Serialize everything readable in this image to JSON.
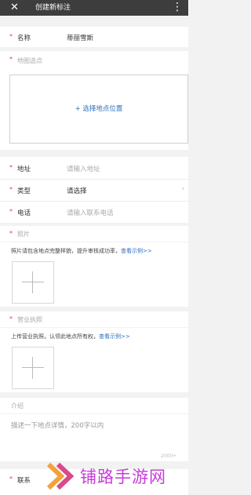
{
  "header": {
    "close_icon": "close-icon",
    "title": "创建新标注",
    "more_icon": "more-vertical-icon"
  },
  "required_mark": "*",
  "fields": {
    "name": {
      "label": "名称",
      "value": "蒂丽雪斯"
    },
    "map_pick": {
      "label": "地图选点",
      "link": "+ 选择地点位置"
    },
    "address": {
      "label": "地址",
      "placeholder": "请输入地址"
    },
    "type": {
      "label": "类型",
      "value": "请选择",
      "chevron": "›"
    },
    "phone": {
      "label": "电话",
      "placeholder": "请输入联系电话"
    },
    "photos": {
      "label": "照片",
      "hint": "照片请包含地点完整样貌，提升审核成功率，",
      "hint_link": "查看示例>>"
    },
    "license": {
      "label": "营业执照",
      "hint": "上传营业执照，认领此地点所有权，",
      "hint_link": "查看示例>>"
    },
    "intro": {
      "label": "介绍",
      "placeholder": "描述一下地点详情，200字以内"
    },
    "contact": {
      "label": "联系"
    }
  },
  "watermark": {
    "text": "铺路手游网",
    "small": "2000+",
    "color": "#c63bd9"
  }
}
